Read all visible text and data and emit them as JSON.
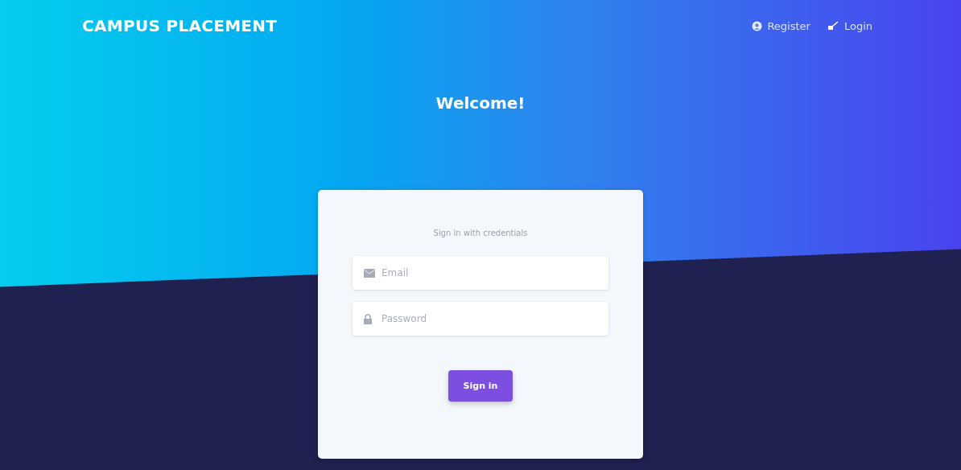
{
  "navbar": {
    "brand": "CAMPUS PLACEMENT",
    "links": [
      {
        "kind": "register",
        "label": "Register"
      },
      {
        "kind": "login",
        "label": "Login"
      }
    ]
  },
  "hero": {
    "title": "Welcome!"
  },
  "login_card": {
    "subtitle": "Sign in with credentials",
    "fields": [
      {
        "kind": "email",
        "placeholder": "Email"
      },
      {
        "kind": "password",
        "placeholder": "Password"
      }
    ],
    "button": "Sign in"
  }
}
